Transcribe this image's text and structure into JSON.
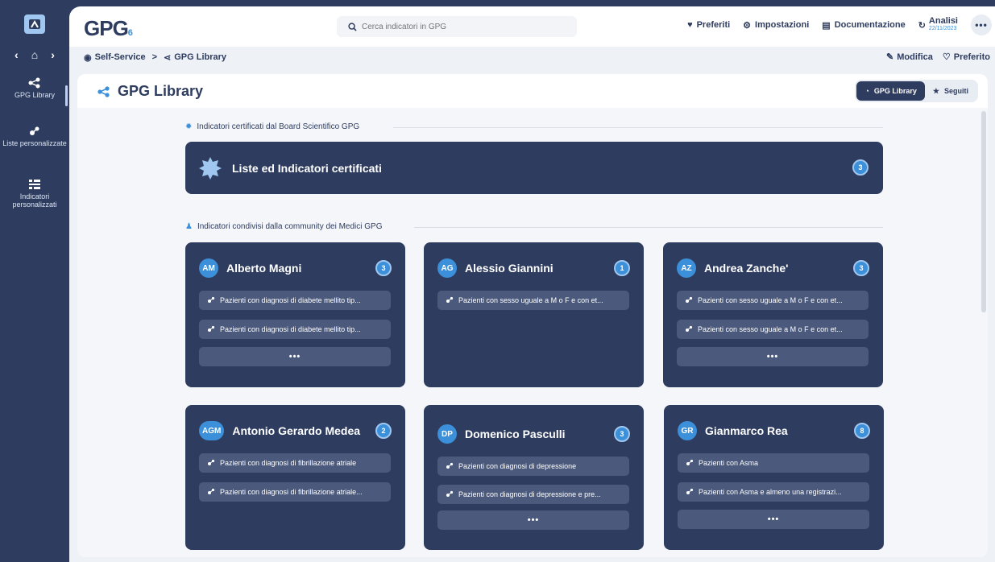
{
  "sidebar": {
    "items": [
      {
        "label": "GPG Library",
        "icon": "share-icon"
      },
      {
        "label": "Liste personalizzate",
        "icon": "molecule-icon"
      },
      {
        "label": "Indicatori personalizzati",
        "icon": "list-icon"
      }
    ]
  },
  "topbar": {
    "brand": "GPG",
    "brand_suffix": "6",
    "search_placeholder": "Cerca indicatori in GPG",
    "preferiti": "Preferiti",
    "impostazioni": "Impostazioni",
    "documentazione": "Documentazione",
    "analisi_label": "Analisi",
    "analisi_date": "22/11/2023",
    "more": "•••"
  },
  "breadcrumb": {
    "items": [
      "Self-Service",
      "GPG Library"
    ],
    "sep": ">",
    "modifica": "Modifica",
    "preferito": "Preferito"
  },
  "panel": {
    "title": "GPG Library",
    "tabs": [
      "GPG Library",
      "Seguiti"
    ]
  },
  "certified": {
    "section_label": "Indicatori certificati dal Board Scientifico GPG",
    "card_title": "Liste ed Indicatori certificati",
    "count": "3"
  },
  "community": {
    "section_label": "Indicatori condivisi dalla community dei Medici GPG",
    "more_label": "•••",
    "cards": [
      {
        "initials": "AM",
        "name": "Alberto Magni",
        "count": "3",
        "items": [
          "Pazienti con diagnosi di diabete mellito tip...",
          "Pazienti con diagnosi di diabete mellito tip..."
        ]
      },
      {
        "initials": "AG",
        "name": "Alessio Giannini",
        "count": "1",
        "items": [
          "Pazienti con sesso uguale a M o F e con et..."
        ]
      },
      {
        "initials": "AZ",
        "name": "Andrea Zanche'",
        "count": "3",
        "items": [
          "Pazienti con sesso uguale a M o F e con et...",
          "Pazienti con sesso uguale a M o F e con et..."
        ]
      },
      {
        "initials": "AGM",
        "name": "Antonio Gerardo Medea",
        "count": "2",
        "items": [
          "Pazienti con diagnosi di fibrillazione atriale",
          "Pazienti con diagnosi di fibrillazione atriale..."
        ]
      },
      {
        "initials": "DP",
        "name": "Domenico Pasculli",
        "count": "3",
        "items": [
          "Pazienti con diagnosi di depressione",
          "Pazienti con diagnosi di depressione e pre..."
        ]
      },
      {
        "initials": "GR",
        "name": "Gianmarco Rea",
        "count": "8",
        "items": [
          "Pazienti con Asma",
          "Pazienti con Asma e almeno una registrazi..."
        ]
      }
    ]
  },
  "colors": {
    "navy": "#2e3c5f",
    "accent": "#3c8fd9",
    "row": "#4b5a7c"
  }
}
